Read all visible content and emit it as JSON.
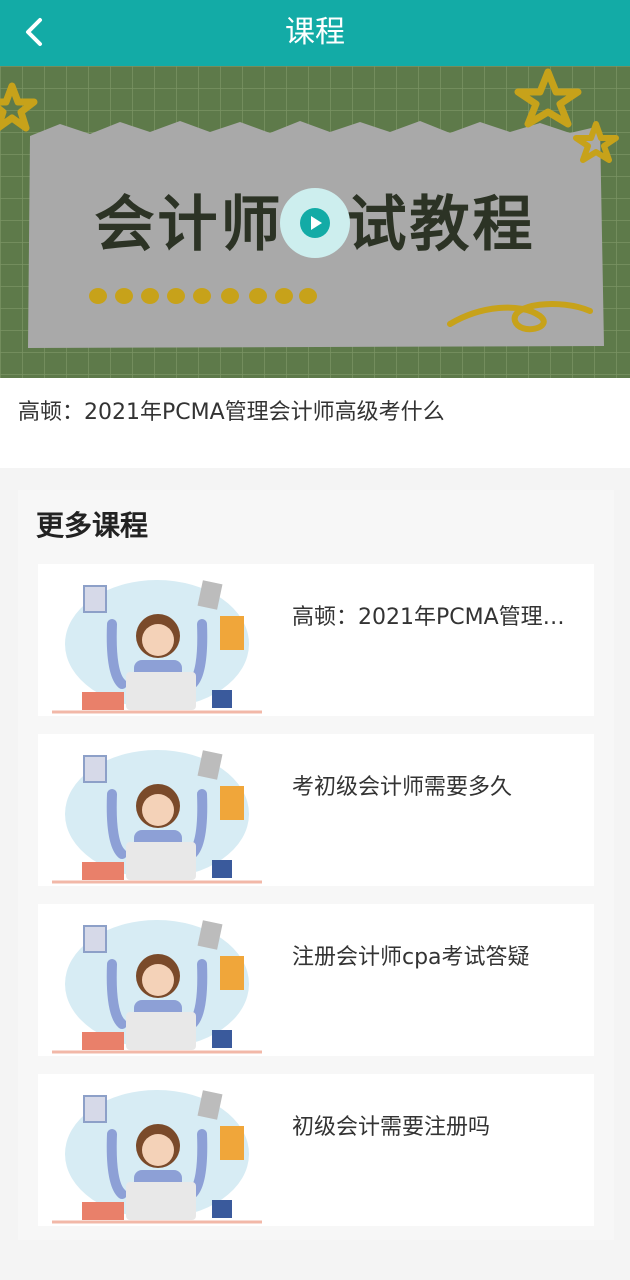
{
  "header": {
    "title": "课程",
    "back_icon": "chevron-left-icon"
  },
  "player": {
    "banner_text": "会计师考试教程",
    "play_icon": "play-circle-icon",
    "colors": {
      "board": "#5e7a4a",
      "paper": "#a9a9a9",
      "accent": "#c7a21a"
    }
  },
  "course": {
    "title": "高顿：2021年PCMA管理会计师高级考什么"
  },
  "more": {
    "heading": "更多课程",
    "items": [
      {
        "title": "高顿：2021年PCMA管理会计师高级考什么"
      },
      {
        "title": "考初级会计师需要多久"
      },
      {
        "title": "注册会计师cpa考试答疑"
      },
      {
        "title": "初级会计需要注册吗"
      }
    ]
  },
  "theme": {
    "accent": "#13aba6"
  }
}
